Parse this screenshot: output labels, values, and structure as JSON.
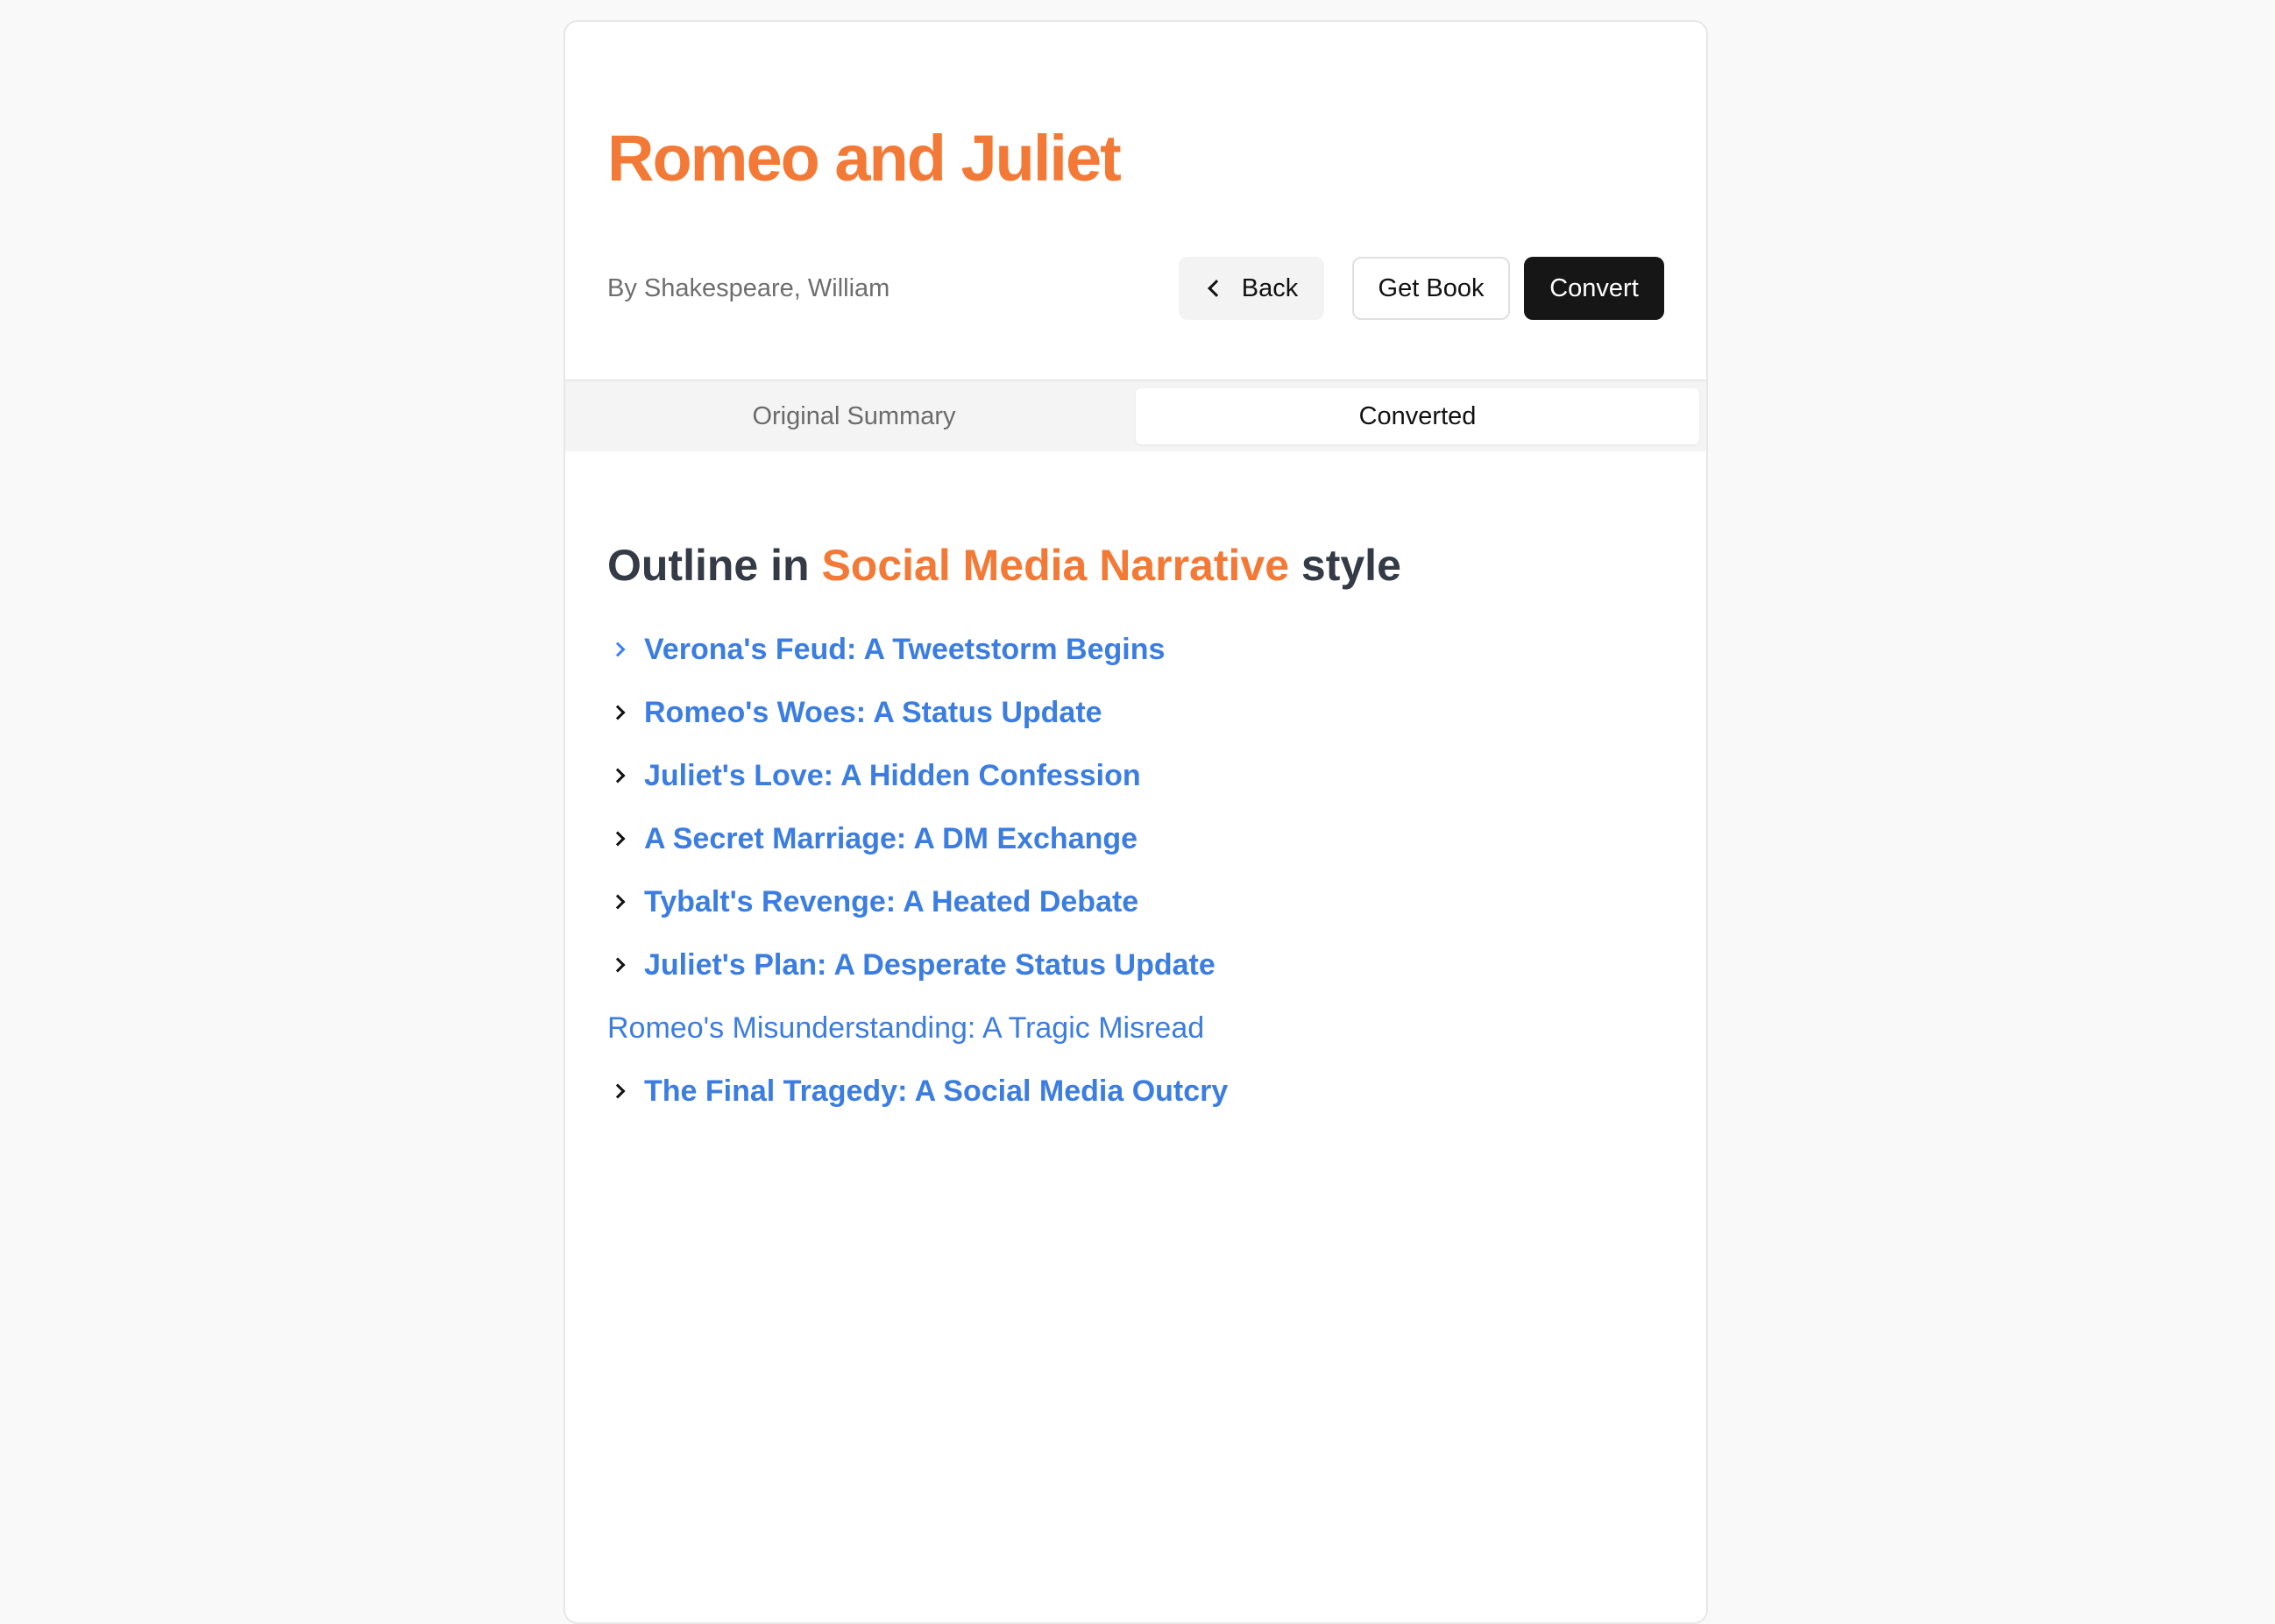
{
  "book": {
    "title": "Romeo and Juliet",
    "author": "By Shakespeare, William"
  },
  "actions": {
    "back_label": "Back",
    "get_book_label": "Get Book",
    "convert_label": "Convert"
  },
  "tabs": [
    {
      "label": "Original Summary",
      "active": false
    },
    {
      "label": "Converted",
      "active": true
    }
  ],
  "outline": {
    "prefix": "Outline in ",
    "style_name": "Social Media Narrative",
    "suffix": " style",
    "items": [
      {
        "label": "Verona's Feud: A Tweetstorm Begins",
        "icon": "chevron-right-icon"
      },
      {
        "label": "Romeo's Woes: A Status Update",
        "icon": "chevron-right-icon"
      },
      {
        "label": "Juliet's Love: A Hidden Confession",
        "icon": "chevron-right-icon"
      },
      {
        "label": "A Secret Marriage: A DM Exchange",
        "icon": "chevron-right-icon"
      },
      {
        "label": "Tybalt's Revenge: A Heated Debate",
        "icon": "chevron-right-icon"
      },
      {
        "label": "Juliet's Plan: A Desperate Status Update",
        "icon": "chevron-right-icon"
      },
      {
        "label": "Romeo's Misunderstanding: A Tragic Misread",
        "icon": ""
      },
      {
        "label": "The Final Tragedy: A Social Media Outcry",
        "icon": "chevron-right-icon"
      }
    ]
  },
  "colors": {
    "accent": "#f37a36",
    "link": "#3b7de0",
    "heading": "#343a46",
    "primary_button": "#161616"
  }
}
